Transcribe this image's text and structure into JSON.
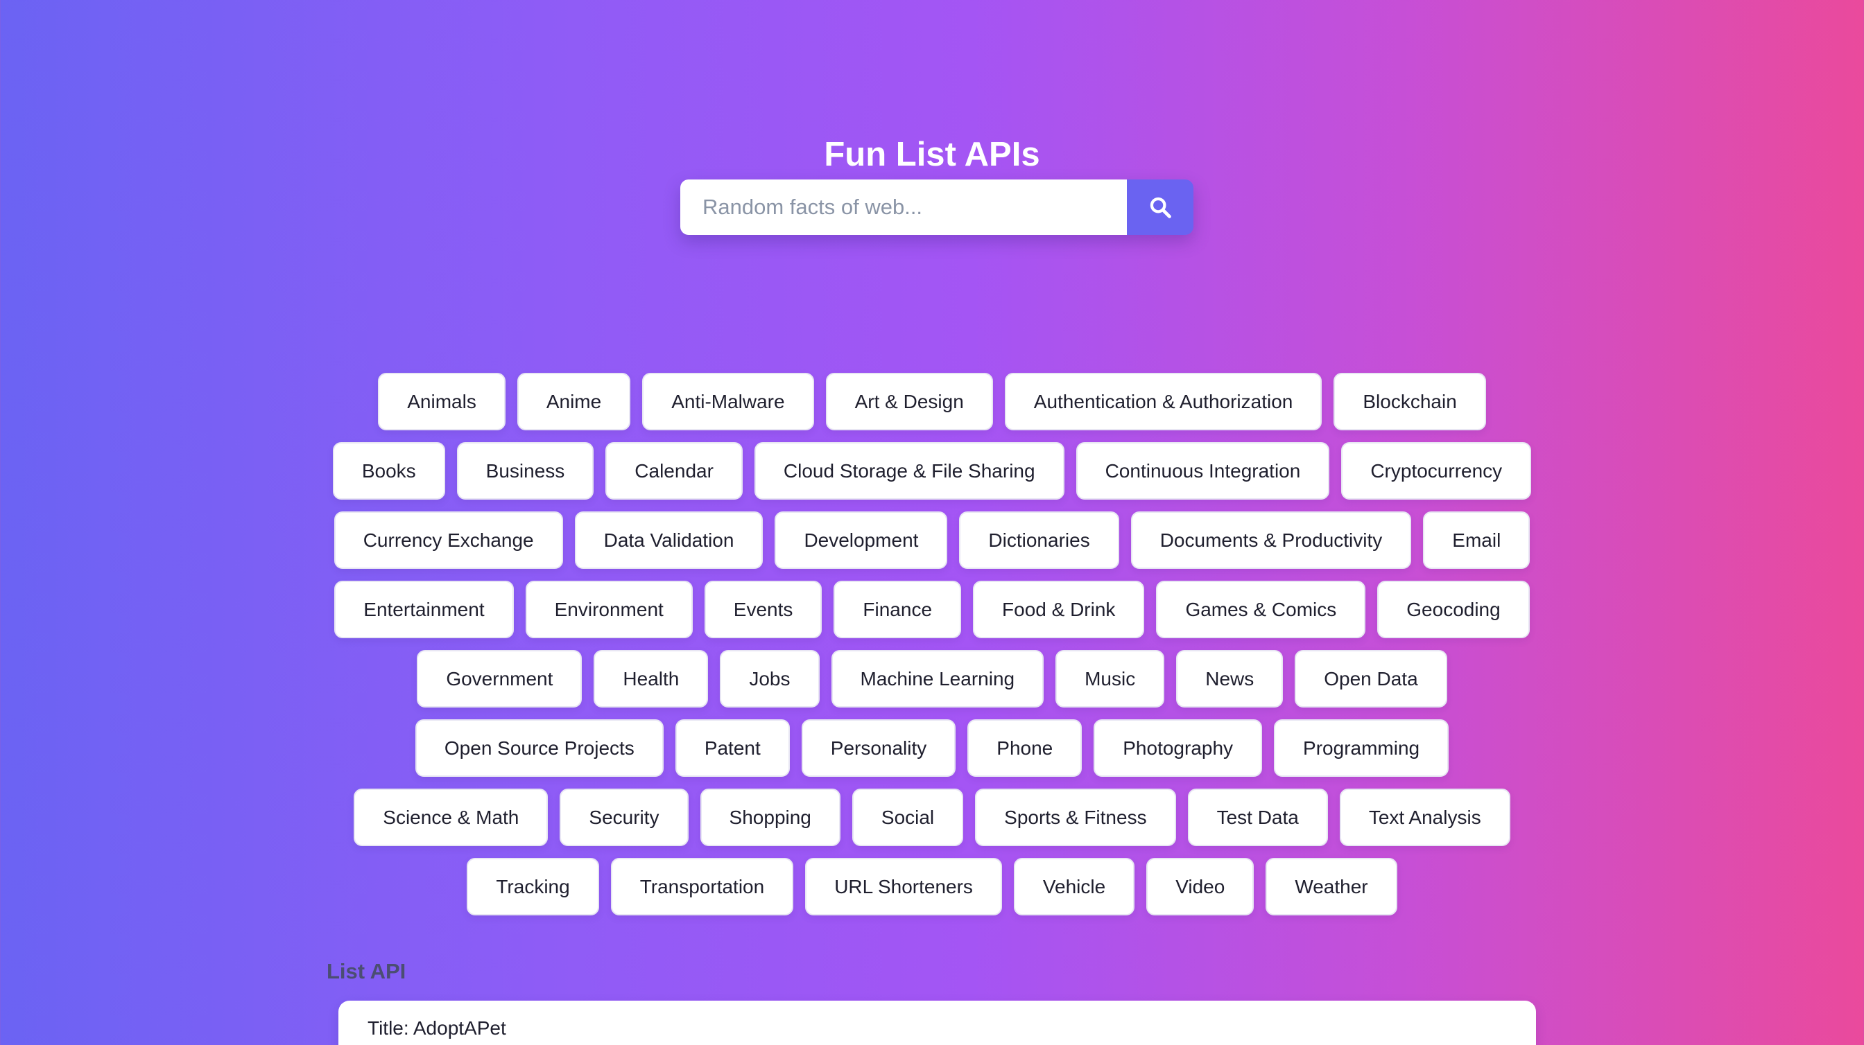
{
  "page": {
    "title": "Fun List APIs"
  },
  "search": {
    "placeholder": "Random facts of web...",
    "value": "",
    "button_icon": "search-icon"
  },
  "categories": [
    [
      "Animals",
      "Anime",
      "Anti-Malware",
      "Art & Design",
      "Authentication & Authorization",
      "Blockchain"
    ],
    [
      "Books",
      "Business",
      "Calendar",
      "Cloud Storage & File Sharing",
      "Continuous Integration",
      "Cryptocurrency"
    ],
    [
      "Currency Exchange",
      "Data Validation",
      "Development",
      "Dictionaries",
      "Documents & Productivity",
      "Email"
    ],
    [
      "Entertainment",
      "Environment",
      "Events",
      "Finance",
      "Food & Drink",
      "Games & Comics",
      "Geocoding"
    ],
    [
      "Government",
      "Health",
      "Jobs",
      "Machine Learning",
      "Music",
      "News",
      "Open Data"
    ],
    [
      "Open Source Projects",
      "Patent",
      "Personality",
      "Phone",
      "Photography",
      "Programming"
    ],
    [
      "Science & Math",
      "Security",
      "Shopping",
      "Social",
      "Sports & Fitness",
      "Test Data",
      "Text Analysis"
    ],
    [
      "Tracking",
      "Transportation",
      "URL Shorteners",
      "Vehicle",
      "Video",
      "Weather"
    ]
  ],
  "list_section": {
    "label": "List API",
    "first_item_title": "Title: AdoptAPet"
  },
  "colors": {
    "gradient_start": "#6b63f3",
    "gradient_mid": "#a455f4",
    "gradient_end": "#ea4a9c",
    "search_button": "#6a63f1",
    "tag_background": "#ffffff"
  }
}
